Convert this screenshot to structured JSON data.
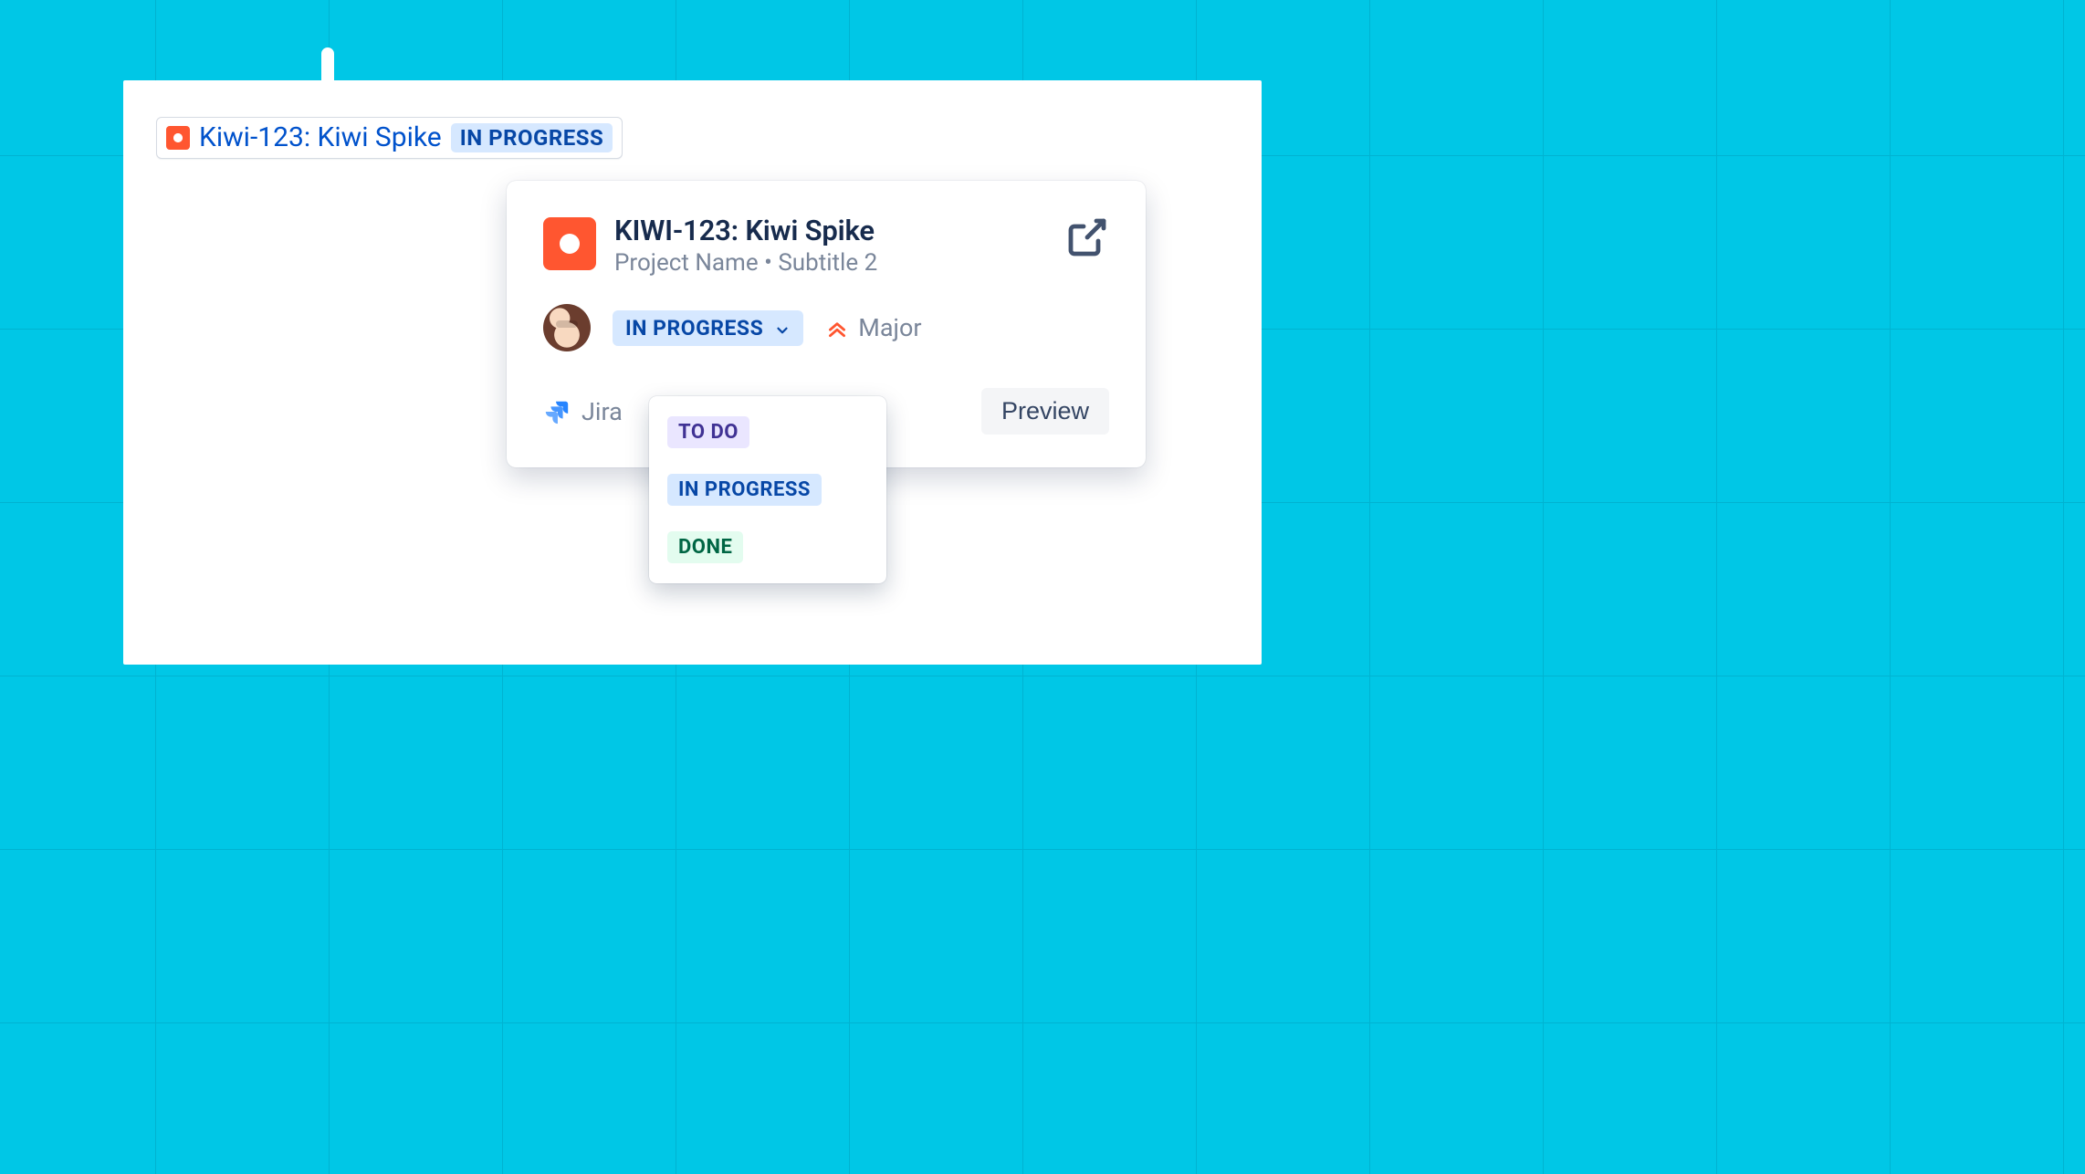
{
  "smart_link": {
    "issue_key_title": "Kiwi-123: Kiwi Spike",
    "status": "IN PROGRESS"
  },
  "card": {
    "title": "KIWI-123: Kiwi Spike",
    "subtitle_project": "Project Name",
    "subtitle_separator": "•",
    "subtitle_extra": "Subtitle 2",
    "status_selected": "IN PROGRESS",
    "priority_label": "Major",
    "source_app": "Jira",
    "preview_button": "Preview"
  },
  "status_menu": {
    "options": [
      {
        "label": "TO DO",
        "class": "opt-todo"
      },
      {
        "label": "IN PROGRESS",
        "class": "opt-inprog"
      },
      {
        "label": "DONE",
        "class": "opt-done"
      }
    ]
  },
  "colors": {
    "bg": "#00c7e6",
    "issue_icon": "#ff5630",
    "link": "#0052cc",
    "status_bg": "#d6e8ff",
    "status_fg": "#0747a6"
  }
}
